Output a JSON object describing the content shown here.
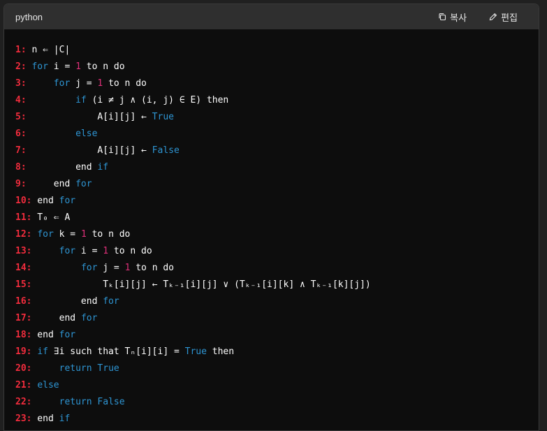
{
  "header": {
    "language": "python",
    "copy_label": "복사",
    "edit_label": "편집",
    "copy_icon": "copy-icon",
    "edit_icon": "pencil-icon"
  },
  "colors": {
    "keyword": "#2e95d3",
    "number": "#df3079",
    "line_number": "#f22c3d",
    "text": "#ffffff",
    "background": "#0d0d0d",
    "header_bg": "#2f2f2f"
  },
  "code": {
    "lines": [
      [
        {
          "t": "ln",
          "v": "1:"
        },
        {
          "t": "txt",
          "v": " n ⇐ |C|"
        }
      ],
      [
        {
          "t": "ln",
          "v": "2:"
        },
        {
          "t": "txt",
          "v": " "
        },
        {
          "t": "kw",
          "v": "for"
        },
        {
          "t": "txt",
          "v": " i = "
        },
        {
          "t": "num",
          "v": "1"
        },
        {
          "t": "txt",
          "v": " to n do"
        }
      ],
      [
        {
          "t": "ln",
          "v": "3:"
        },
        {
          "t": "txt",
          "v": "     "
        },
        {
          "t": "kw",
          "v": "for"
        },
        {
          "t": "txt",
          "v": " j = "
        },
        {
          "t": "num",
          "v": "1"
        },
        {
          "t": "txt",
          "v": " to n do"
        }
      ],
      [
        {
          "t": "ln",
          "v": "4:"
        },
        {
          "t": "txt",
          "v": "         "
        },
        {
          "t": "kw",
          "v": "if"
        },
        {
          "t": "txt",
          "v": " (i ≠ j ∧ (i, j) ∈ E) then"
        }
      ],
      [
        {
          "t": "ln",
          "v": "5:"
        },
        {
          "t": "txt",
          "v": "             A[i][j] ← "
        },
        {
          "t": "kw",
          "v": "True"
        }
      ],
      [
        {
          "t": "ln",
          "v": "6:"
        },
        {
          "t": "txt",
          "v": "         "
        },
        {
          "t": "kw",
          "v": "else"
        }
      ],
      [
        {
          "t": "ln",
          "v": "7:"
        },
        {
          "t": "txt",
          "v": "             A[i][j] ← "
        },
        {
          "t": "kw",
          "v": "False"
        }
      ],
      [
        {
          "t": "ln",
          "v": "8:"
        },
        {
          "t": "txt",
          "v": "         end "
        },
        {
          "t": "kw",
          "v": "if"
        }
      ],
      [
        {
          "t": "ln",
          "v": "9:"
        },
        {
          "t": "txt",
          "v": "     end "
        },
        {
          "t": "kw",
          "v": "for"
        }
      ],
      [
        {
          "t": "ln",
          "v": "10:"
        },
        {
          "t": "txt",
          "v": " end "
        },
        {
          "t": "kw",
          "v": "for"
        }
      ],
      [
        {
          "t": "ln",
          "v": "11:"
        },
        {
          "t": "txt",
          "v": " T₀ ⇐ A"
        }
      ],
      [
        {
          "t": "ln",
          "v": "12:"
        },
        {
          "t": "txt",
          "v": " "
        },
        {
          "t": "kw",
          "v": "for"
        },
        {
          "t": "txt",
          "v": " k = "
        },
        {
          "t": "num",
          "v": "1"
        },
        {
          "t": "txt",
          "v": " to n do"
        }
      ],
      [
        {
          "t": "ln",
          "v": "13:"
        },
        {
          "t": "txt",
          "v": "     "
        },
        {
          "t": "kw",
          "v": "for"
        },
        {
          "t": "txt",
          "v": " i = "
        },
        {
          "t": "num",
          "v": "1"
        },
        {
          "t": "txt",
          "v": " to n do"
        }
      ],
      [
        {
          "t": "ln",
          "v": "14:"
        },
        {
          "t": "txt",
          "v": "         "
        },
        {
          "t": "kw",
          "v": "for"
        },
        {
          "t": "txt",
          "v": " j = "
        },
        {
          "t": "num",
          "v": "1"
        },
        {
          "t": "txt",
          "v": " to n do"
        }
      ],
      [
        {
          "t": "ln",
          "v": "15:"
        },
        {
          "t": "txt",
          "v": "             Tₖ[i][j] ← Tₖ₋₁[i][j] ∨ (Tₖ₋₁[i][k] ∧ Tₖ₋₁[k][j])"
        }
      ],
      [
        {
          "t": "ln",
          "v": "16:"
        },
        {
          "t": "txt",
          "v": "         end "
        },
        {
          "t": "kw",
          "v": "for"
        }
      ],
      [
        {
          "t": "ln",
          "v": "17:"
        },
        {
          "t": "txt",
          "v": "     end "
        },
        {
          "t": "kw",
          "v": "for"
        }
      ],
      [
        {
          "t": "ln",
          "v": "18:"
        },
        {
          "t": "txt",
          "v": " end "
        },
        {
          "t": "kw",
          "v": "for"
        }
      ],
      [
        {
          "t": "ln",
          "v": "19:"
        },
        {
          "t": "txt",
          "v": " "
        },
        {
          "t": "kw",
          "v": "if"
        },
        {
          "t": "txt",
          "v": " ∃i such that Tₙ[i][i] = "
        },
        {
          "t": "kw",
          "v": "True"
        },
        {
          "t": "txt",
          "v": " then"
        }
      ],
      [
        {
          "t": "ln",
          "v": "20:"
        },
        {
          "t": "txt",
          "v": "     "
        },
        {
          "t": "kw",
          "v": "return True"
        }
      ],
      [
        {
          "t": "ln",
          "v": "21:"
        },
        {
          "t": "txt",
          "v": " "
        },
        {
          "t": "kw",
          "v": "else"
        }
      ],
      [
        {
          "t": "ln",
          "v": "22:"
        },
        {
          "t": "txt",
          "v": "     "
        },
        {
          "t": "kw",
          "v": "return False"
        }
      ],
      [
        {
          "t": "ln",
          "v": "23:"
        },
        {
          "t": "txt",
          "v": " end "
        },
        {
          "t": "kw",
          "v": "if"
        }
      ]
    ]
  }
}
